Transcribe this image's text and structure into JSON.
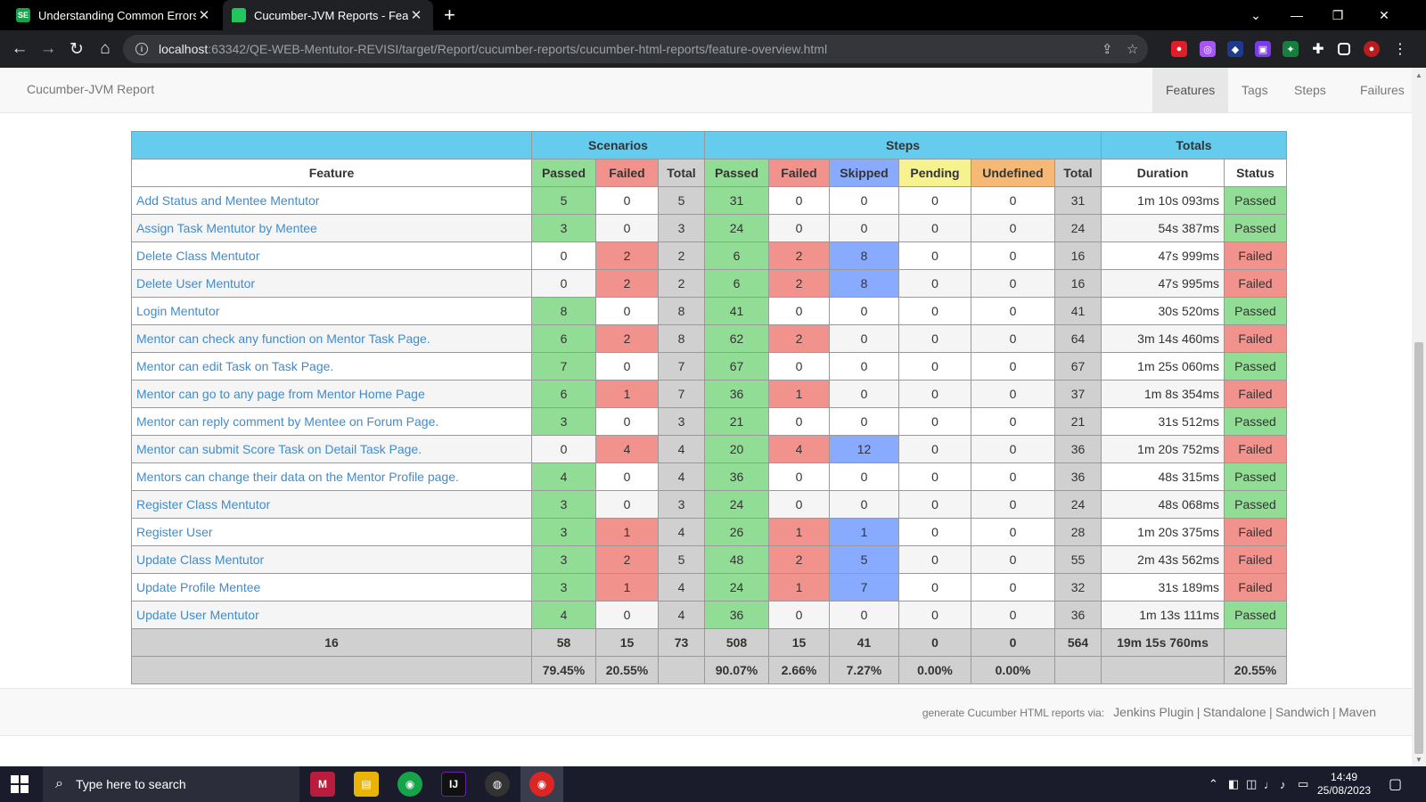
{
  "browser": {
    "tabs": [
      {
        "title": "Understanding Common Errors |",
        "favicon": "SE"
      },
      {
        "title": "Cucumber-JVM Reports - Feature",
        "favicon": ""
      }
    ],
    "url_host": "localhost",
    "url_rest": ":63342/QE-WEB-Mentutor-REVISI/target/Report/cucumber-reports/cucumber-html-reports/feature-overview.html"
  },
  "navbar": {
    "brand": "Cucumber-JVM Report",
    "links": [
      "Features",
      "Tags",
      "Steps",
      "Failures"
    ]
  },
  "table": {
    "groups": {
      "scenarios": "Scenarios",
      "steps": "Steps",
      "totals": "Totals"
    },
    "headers": {
      "feature": "Feature",
      "sc_passed": "Passed",
      "sc_failed": "Failed",
      "sc_total": "Total",
      "st_passed": "Passed",
      "st_failed": "Failed",
      "st_skipped": "Skipped",
      "st_pending": "Pending",
      "st_undefined": "Undefined",
      "st_total": "Total",
      "duration": "Duration",
      "status": "Status"
    },
    "rows": [
      {
        "feature": "Add Status and Mentee Mentutor",
        "sp": "5",
        "sf": "0",
        "st": "5",
        "tp": "31",
        "tf": "0",
        "ts": "0",
        "tpe": "0",
        "tu": "0",
        "tt": "31",
        "dur": "1m 10s 093ms",
        "status": "Passed"
      },
      {
        "feature": "Assign Task Mentutor by Mentee",
        "sp": "3",
        "sf": "0",
        "st": "3",
        "tp": "24",
        "tf": "0",
        "ts": "0",
        "tpe": "0",
        "tu": "0",
        "tt": "24",
        "dur": "54s 387ms",
        "status": "Passed"
      },
      {
        "feature": "Delete Class Mentutor",
        "sp": "0",
        "sf": "2",
        "st": "2",
        "tp": "6",
        "tf": "2",
        "ts": "8",
        "tpe": "0",
        "tu": "0",
        "tt": "16",
        "dur": "47s 999ms",
        "status": "Failed"
      },
      {
        "feature": "Delete User Mentutor",
        "sp": "0",
        "sf": "2",
        "st": "2",
        "tp": "6",
        "tf": "2",
        "ts": "8",
        "tpe": "0",
        "tu": "0",
        "tt": "16",
        "dur": "47s 995ms",
        "status": "Failed"
      },
      {
        "feature": "Login Mentutor",
        "sp": "8",
        "sf": "0",
        "st": "8",
        "tp": "41",
        "tf": "0",
        "ts": "0",
        "tpe": "0",
        "tu": "0",
        "tt": "41",
        "dur": "30s 520ms",
        "status": "Passed"
      },
      {
        "feature": "Mentor can check any function on Mentor Task Page.",
        "sp": "6",
        "sf": "2",
        "st": "8",
        "tp": "62",
        "tf": "2",
        "ts": "0",
        "tpe": "0",
        "tu": "0",
        "tt": "64",
        "dur": "3m 14s 460ms",
        "status": "Failed"
      },
      {
        "feature": "Mentor can edit Task on Task Page.",
        "sp": "7",
        "sf": "0",
        "st": "7",
        "tp": "67",
        "tf": "0",
        "ts": "0",
        "tpe": "0",
        "tu": "0",
        "tt": "67",
        "dur": "1m 25s 060ms",
        "status": "Passed"
      },
      {
        "feature": "Mentor can go to any page from Mentor Home Page",
        "sp": "6",
        "sf": "1",
        "st": "7",
        "tp": "36",
        "tf": "1",
        "ts": "0",
        "tpe": "0",
        "tu": "0",
        "tt": "37",
        "dur": "1m 8s 354ms",
        "status": "Failed"
      },
      {
        "feature": "Mentor can reply comment by Mentee on Forum Page.",
        "sp": "3",
        "sf": "0",
        "st": "3",
        "tp": "21",
        "tf": "0",
        "ts": "0",
        "tpe": "0",
        "tu": "0",
        "tt": "21",
        "dur": "31s 512ms",
        "status": "Passed"
      },
      {
        "feature": "Mentor can submit Score Task on Detail Task Page.",
        "sp": "0",
        "sf": "4",
        "st": "4",
        "tp": "20",
        "tf": "4",
        "ts": "12",
        "tpe": "0",
        "tu": "0",
        "tt": "36",
        "dur": "1m 20s 752ms",
        "status": "Failed"
      },
      {
        "feature": "Mentors can change their data on the Mentor Profile page.",
        "sp": "4",
        "sf": "0",
        "st": "4",
        "tp": "36",
        "tf": "0",
        "ts": "0",
        "tpe": "0",
        "tu": "0",
        "tt": "36",
        "dur": "48s 315ms",
        "status": "Passed"
      },
      {
        "feature": "Register Class Mentutor",
        "sp": "3",
        "sf": "0",
        "st": "3",
        "tp": "24",
        "tf": "0",
        "ts": "0",
        "tpe": "0",
        "tu": "0",
        "tt": "24",
        "dur": "48s 068ms",
        "status": "Passed"
      },
      {
        "feature": "Register User",
        "sp": "3",
        "sf": "1",
        "st": "4",
        "tp": "26",
        "tf": "1",
        "ts": "1",
        "tpe": "0",
        "tu": "0",
        "tt": "28",
        "dur": "1m 20s 375ms",
        "status": "Failed"
      },
      {
        "feature": "Update Class Mentutor",
        "sp": "3",
        "sf": "2",
        "st": "5",
        "tp": "48",
        "tf": "2",
        "ts": "5",
        "tpe": "0",
        "tu": "0",
        "tt": "55",
        "dur": "2m 43s 562ms",
        "status": "Failed"
      },
      {
        "feature": "Update Profile Mentee",
        "sp": "3",
        "sf": "1",
        "st": "4",
        "tp": "24",
        "tf": "1",
        "ts": "7",
        "tpe": "0",
        "tu": "0",
        "tt": "32",
        "dur": "31s 189ms",
        "status": "Failed"
      },
      {
        "feature": "Update User Mentutor",
        "sp": "4",
        "sf": "0",
        "st": "4",
        "tp": "36",
        "tf": "0",
        "ts": "0",
        "tpe": "0",
        "tu": "0",
        "tt": "36",
        "dur": "1m 13s 111ms",
        "status": "Passed"
      }
    ],
    "totals": {
      "feature": "16",
      "sp": "58",
      "sf": "15",
      "st": "73",
      "tp": "508",
      "tf": "15",
      "ts": "41",
      "tpe": "0",
      "tu": "0",
      "tt": "564",
      "dur": "19m 15s 760ms",
      "status": ""
    },
    "percent": {
      "feature": "",
      "sp": "79.45%",
      "sf": "20.55%",
      "st": "",
      "tp": "90.07%",
      "tf": "2.66%",
      "ts": "7.27%",
      "tpe": "0.00%",
      "tu": "0.00%",
      "tt": "",
      "dur": "",
      "status": "20.55%"
    }
  },
  "footer": {
    "prefix": "generate Cucumber HTML reports via:",
    "links": [
      "Jenkins Plugin",
      "Standalone",
      "Sandwich",
      "Maven"
    ]
  },
  "taskbar": {
    "search_placeholder": "Type here to search",
    "time": "14:49",
    "date": "25/08/2023"
  }
}
